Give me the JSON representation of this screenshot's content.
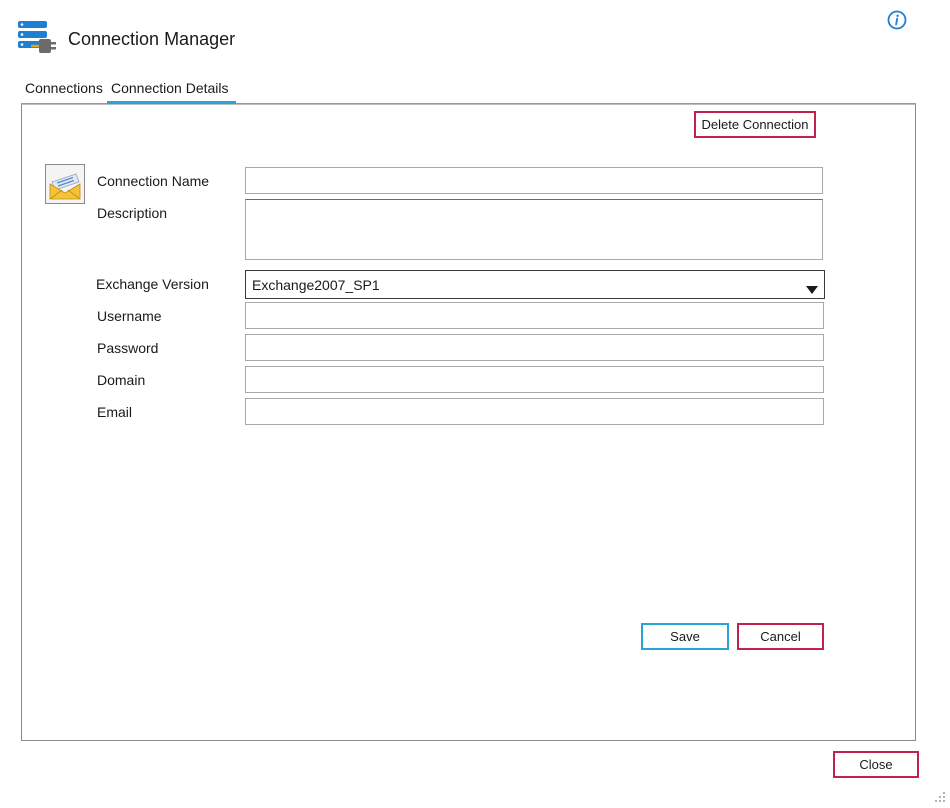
{
  "window": {
    "title": "Connection Manager",
    "app_icon": "server-plug-icon",
    "info_icon": "info-icon"
  },
  "tabs": [
    {
      "label": "Connections",
      "active": false
    },
    {
      "label": "Connection Details",
      "active": true
    }
  ],
  "details": {
    "delete_label": "Delete Connection",
    "connection_icon": "envelope-icon",
    "fields": {
      "connection_name": {
        "label": "Connection Name",
        "value": ""
      },
      "description": {
        "label": "Description",
        "value": ""
      },
      "exchange_version": {
        "label": "Exchange Version",
        "value": "Exchange2007_SP1"
      },
      "username": {
        "label": "Username",
        "value": ""
      },
      "password": {
        "label": "Password",
        "value": ""
      },
      "domain": {
        "label": "Domain",
        "value": ""
      },
      "email": {
        "label": "Email",
        "value": ""
      }
    },
    "save_label": "Save",
    "cancel_label": "Cancel"
  },
  "footer": {
    "close_label": "Close"
  },
  "colors": {
    "accent_blue": "#27a3d6",
    "accent_red": "#c0224b",
    "icon_blue": "#1f7fd1"
  }
}
